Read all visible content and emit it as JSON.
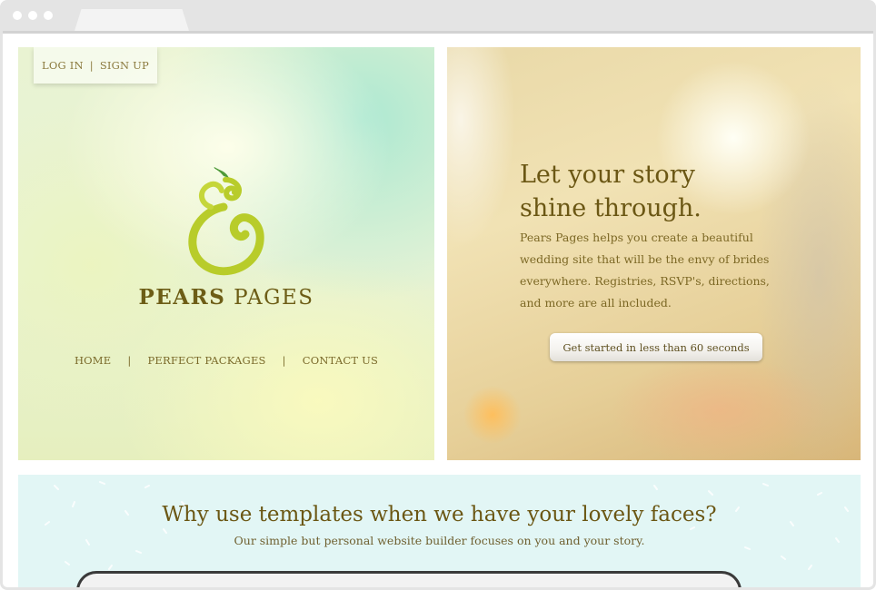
{
  "header": {
    "login_label": "LOG IN",
    "auth_separator": "|",
    "signup_label": "SIGN UP"
  },
  "brand": {
    "word1": "PEARS",
    "word2": "PAGES",
    "logo_icon": "pear-ampersand-icon"
  },
  "nav": {
    "items": [
      {
        "label": "HOME"
      },
      {
        "label": "PERFECT PACKAGES"
      },
      {
        "label": "CONTACT US"
      }
    ],
    "separator": "|"
  },
  "hero": {
    "title_line1": "Let your story",
    "title_line2": "shine through.",
    "body": "Pears Pages helps you create a beautiful wedding site that will be the envy of brides everywhere. Registries, RSVP's, directions, and more are all included.",
    "cta_label": "Get started in less than 60 seconds"
  },
  "section": {
    "title": "Why use templates when we have your lovely faces?",
    "subtitle": "Our simple but personal website builder focuses on you and your story."
  },
  "colors": {
    "brand_text": "#6d5d16",
    "logo_green": "#b8cc2a",
    "leaf_green": "#4f9a3a",
    "section_bg": "#e2f6f5"
  }
}
